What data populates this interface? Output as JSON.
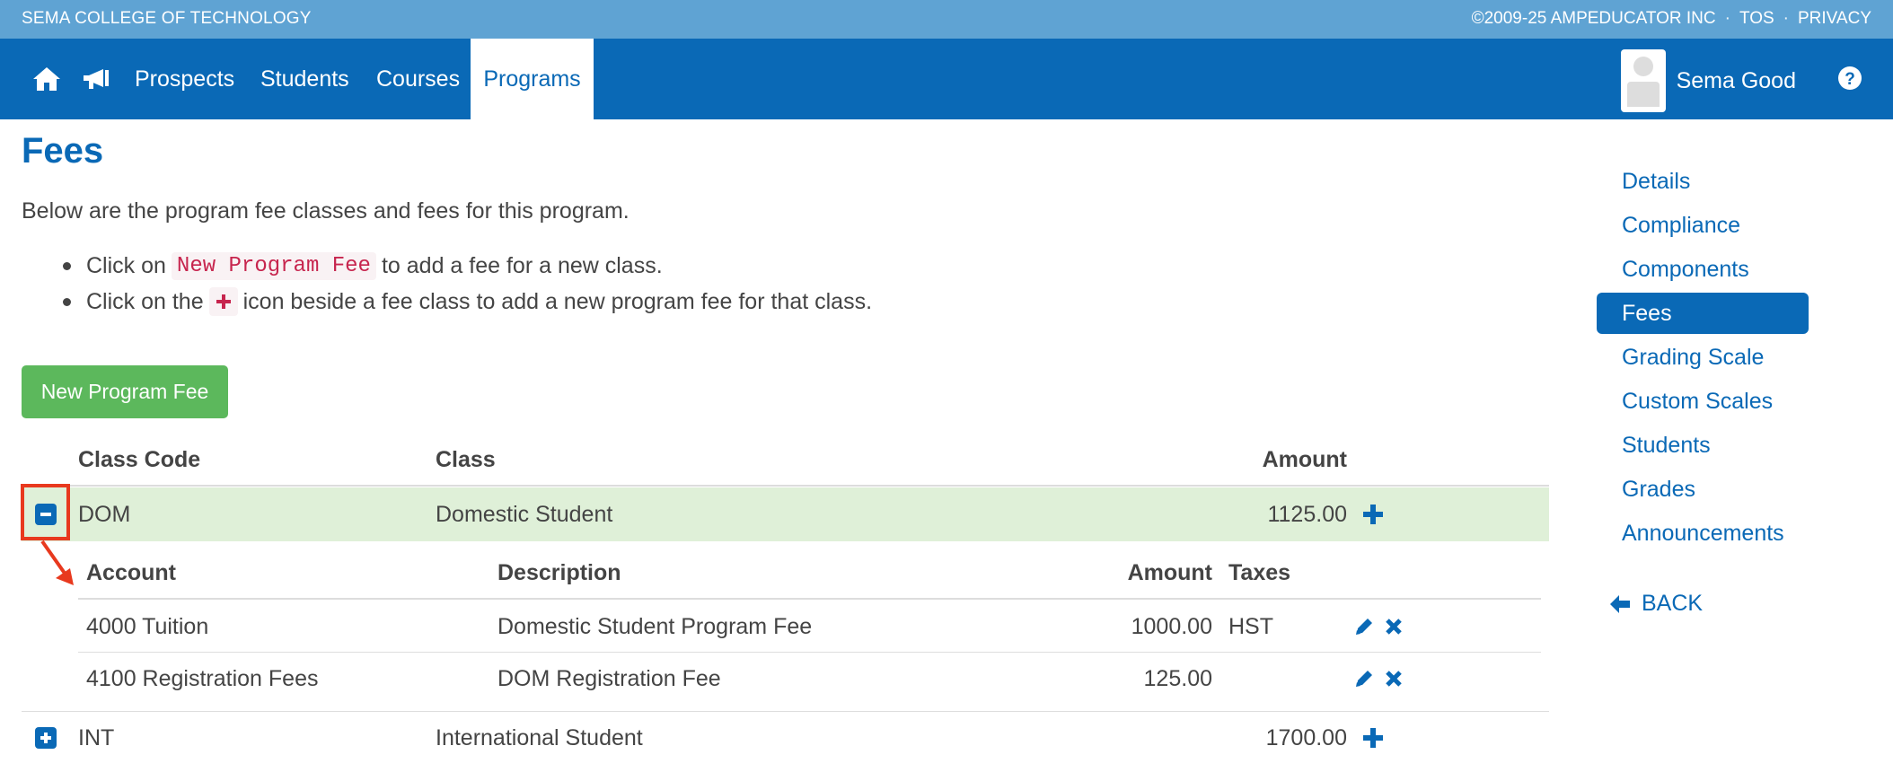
{
  "topbar": {
    "brand": "SEMA COLLEGE OF TECHNOLOGY",
    "copyright": "©2009-25 AMPEDUCATOR INC",
    "sep": "·",
    "tos": "TOS",
    "privacy": "PRIVACY"
  },
  "nav": {
    "home_icon": "home-icon",
    "announce_icon": "megaphone-icon",
    "items": [
      "Prospects",
      "Students",
      "Courses",
      "Programs"
    ],
    "active": "Programs",
    "user_name": "Sema Good",
    "help_icon": "question-circle-icon"
  },
  "page": {
    "title": "Fees",
    "intro": "Below are the program fee classes and fees for this program.",
    "bullet1_pre": "Click on",
    "bullet1_code": "New Program Fee",
    "bullet1_post": "to add a fee for a new class.",
    "bullet2_pre": "Click on the",
    "bullet2_post": "icon beside a fee class to add a new program fee for that class.",
    "new_button": "New Program Fee"
  },
  "table": {
    "headers": {
      "code": "Class Code",
      "class": "Class",
      "amount": "Amount"
    },
    "rows": [
      {
        "code": "DOM",
        "class": "Domestic Student",
        "amount": "1125.00",
        "expanded": true,
        "sub_headers": {
          "account": "Account",
          "description": "Description",
          "amount": "Amount",
          "taxes": "Taxes"
        },
        "fees": [
          {
            "account": "4000 Tuition",
            "description": "Domestic Student Program Fee",
            "amount": "1000.00",
            "taxes": "HST"
          },
          {
            "account": "4100 Registration Fees",
            "description": "DOM Registration Fee",
            "amount": "125.00",
            "taxes": ""
          }
        ]
      },
      {
        "code": "INT",
        "class": "International Student",
        "amount": "1700.00",
        "expanded": false
      }
    ]
  },
  "sidenav": {
    "items": [
      "Details",
      "Compliance",
      "Components",
      "Fees",
      "Grading Scale",
      "Custom Scales",
      "Students",
      "Grades",
      "Announcements"
    ],
    "active": "Fees",
    "back": "BACK"
  },
  "colors": {
    "primary": "#0a69b6",
    "topbar": "#5fa3d3",
    "success": "#5cb85c",
    "row_highlight": "#dff0d8",
    "annotation": "#e8391e",
    "code_text": "#c7254e"
  }
}
